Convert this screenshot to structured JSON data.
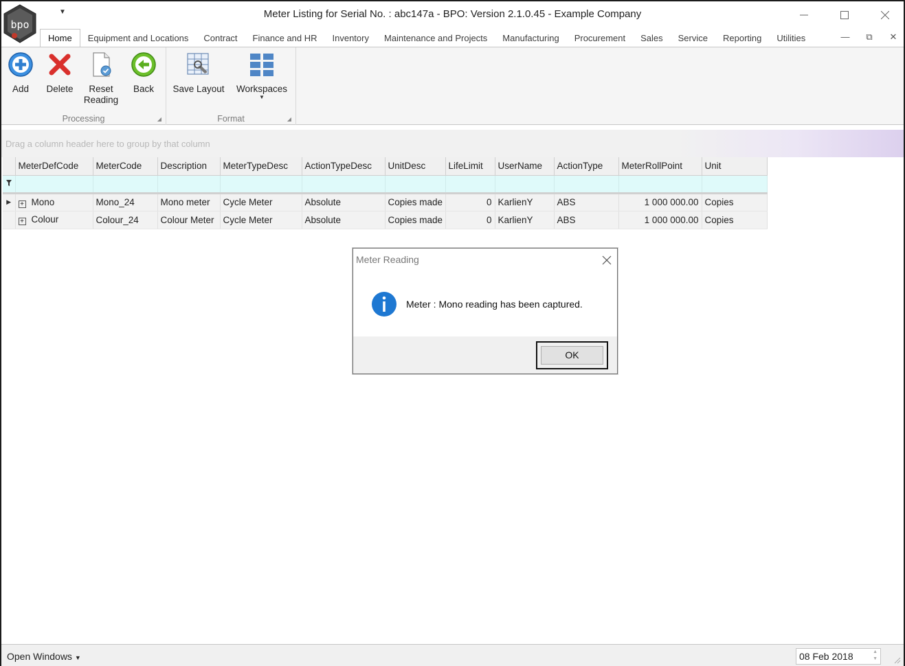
{
  "window": {
    "title": "Meter Listing for Serial No. : abc147a - BPO: Version 2.1.0.45 - Example Company",
    "qat_icon": "dropdown-arrow",
    "controls": [
      "minimize-icon",
      "maximize-icon",
      "close-icon"
    ]
  },
  "ribbon": {
    "tabs": [
      "Home",
      "Equipment and Locations",
      "Contract",
      "Finance and HR",
      "Inventory",
      "Maintenance and Projects",
      "Manufacturing",
      "Procurement",
      "Sales",
      "Service",
      "Reporting",
      "Utilities"
    ],
    "active_tab": "Home",
    "groups": {
      "processing": {
        "label": "Processing",
        "buttons": {
          "add": "Add",
          "delete": "Delete",
          "reset_line1": "Reset",
          "reset_line2": "Reading",
          "back": "Back"
        }
      },
      "format": {
        "label": "Format",
        "buttons": {
          "save_layout": "Save Layout",
          "workspaces": "Workspaces"
        }
      }
    }
  },
  "grid": {
    "group_hint": "Drag a column header here to group by that column",
    "columns": [
      "MeterDefCode",
      "MeterCode",
      "Description",
      "MeterTypeDesc",
      "ActionTypeDesc",
      "UnitDesc",
      "LifeLimit",
      "UserName",
      "ActionType",
      "MeterRollPoint",
      "Unit"
    ],
    "rows": [
      [
        "Mono",
        "Mono_24",
        "Mono meter",
        "Cycle Meter",
        "Absolute",
        "Copies made",
        "0",
        "KarlienY",
        "ABS",
        "1 000 000.00",
        "Copies"
      ],
      [
        "Colour",
        "Colour_24",
        "Colour Meter",
        "Cycle Meter",
        "Absolute",
        "Copies made",
        "0",
        "KarlienY",
        "ABS",
        "1 000 000.00",
        "Copies"
      ]
    ]
  },
  "dialog": {
    "title": "Meter Reading",
    "message": "Meter : Mono reading has been captured.",
    "ok": "OK",
    "icon": "info-icon"
  },
  "statusbar": {
    "open_windows": "Open Windows",
    "date": "08 Feb 2018"
  },
  "colors": {
    "accent_blue": "#1e78d2",
    "delete_red": "#d9302c",
    "back_green": "#6cbf2a",
    "filter_row": "#dffafa"
  }
}
